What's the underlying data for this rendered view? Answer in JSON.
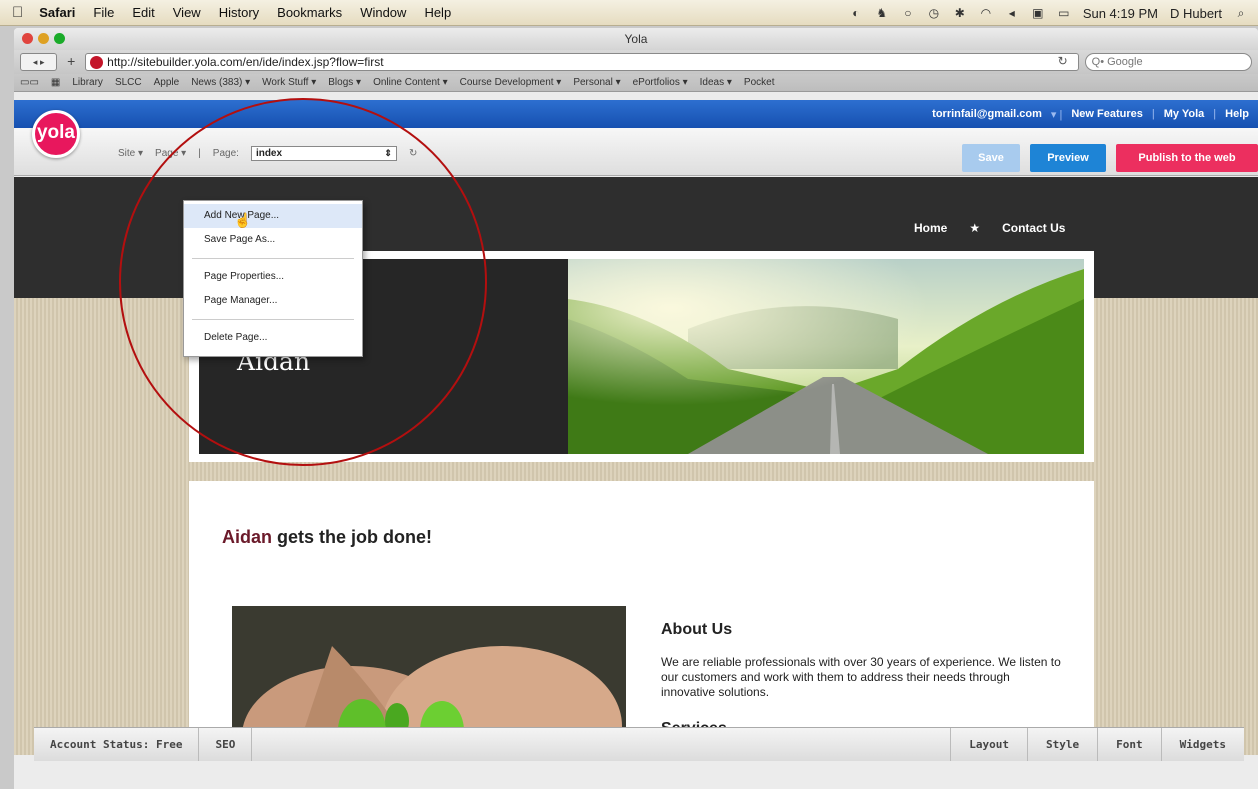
{
  "menubar": {
    "apple": "",
    "items": [
      "Safari",
      "File",
      "Edit",
      "View",
      "History",
      "Bookmarks",
      "Window",
      "Help"
    ],
    "clock": "Sun 4:19 PM",
    "user": "D Hubert"
  },
  "window": {
    "title": "Yola",
    "url": "http://sitebuilder.yola.com/en/ide/index.jsp?flow=first",
    "search_placeholder": "Q• Google"
  },
  "bookmarks": [
    "Library",
    "SLCC",
    "Apple",
    "News (383) ▾",
    "Work Stuff ▾",
    "Blogs ▾",
    "Online Content ▾",
    "Course Development ▾",
    "Personal ▾",
    "ePortfolios ▾",
    "Ideas ▾",
    "Pocket"
  ],
  "yola": {
    "logo": "yola",
    "email": "torrinfail@gmail.com",
    "links": [
      "New Features",
      "My Yola",
      "Help"
    ],
    "site_menu": "Site ▾",
    "page_menu": "Page ▾",
    "page_label": "Page:",
    "page_value": "index",
    "save": "Save",
    "preview": "Preview",
    "publish": "Publish to the web"
  },
  "dropdown": {
    "add_new_page": "Add New Page...",
    "save_page_as": "Save Page As...",
    "page_properties": "Page Properties...",
    "page_manager": "Page Manager...",
    "delete_page": "Delete Page..."
  },
  "site": {
    "nav_home": "Home",
    "nav_star": "★",
    "nav_contact": "Contact Us",
    "banner_name": "Aidan",
    "headline_accent": "Aidan",
    "headline_rest": " gets the job done!",
    "about_title": "About Us",
    "about_text": "We are reliable professionals with over 30 years of experience. We listen to our customers and work with them to address their needs through innovative solutions.",
    "services_title": "Services"
  },
  "bottombar": {
    "account_status": "Account Status: Free",
    "seo": "SEO",
    "layout": "Layout",
    "style": "Style",
    "font": "Font",
    "widgets": "Widgets"
  },
  "colors": {
    "yola_blue": "#1650b0",
    "publish_pink": "#ec2f5f",
    "preview_blue": "#1e84d6",
    "annotation_red": "#b30f0f"
  }
}
